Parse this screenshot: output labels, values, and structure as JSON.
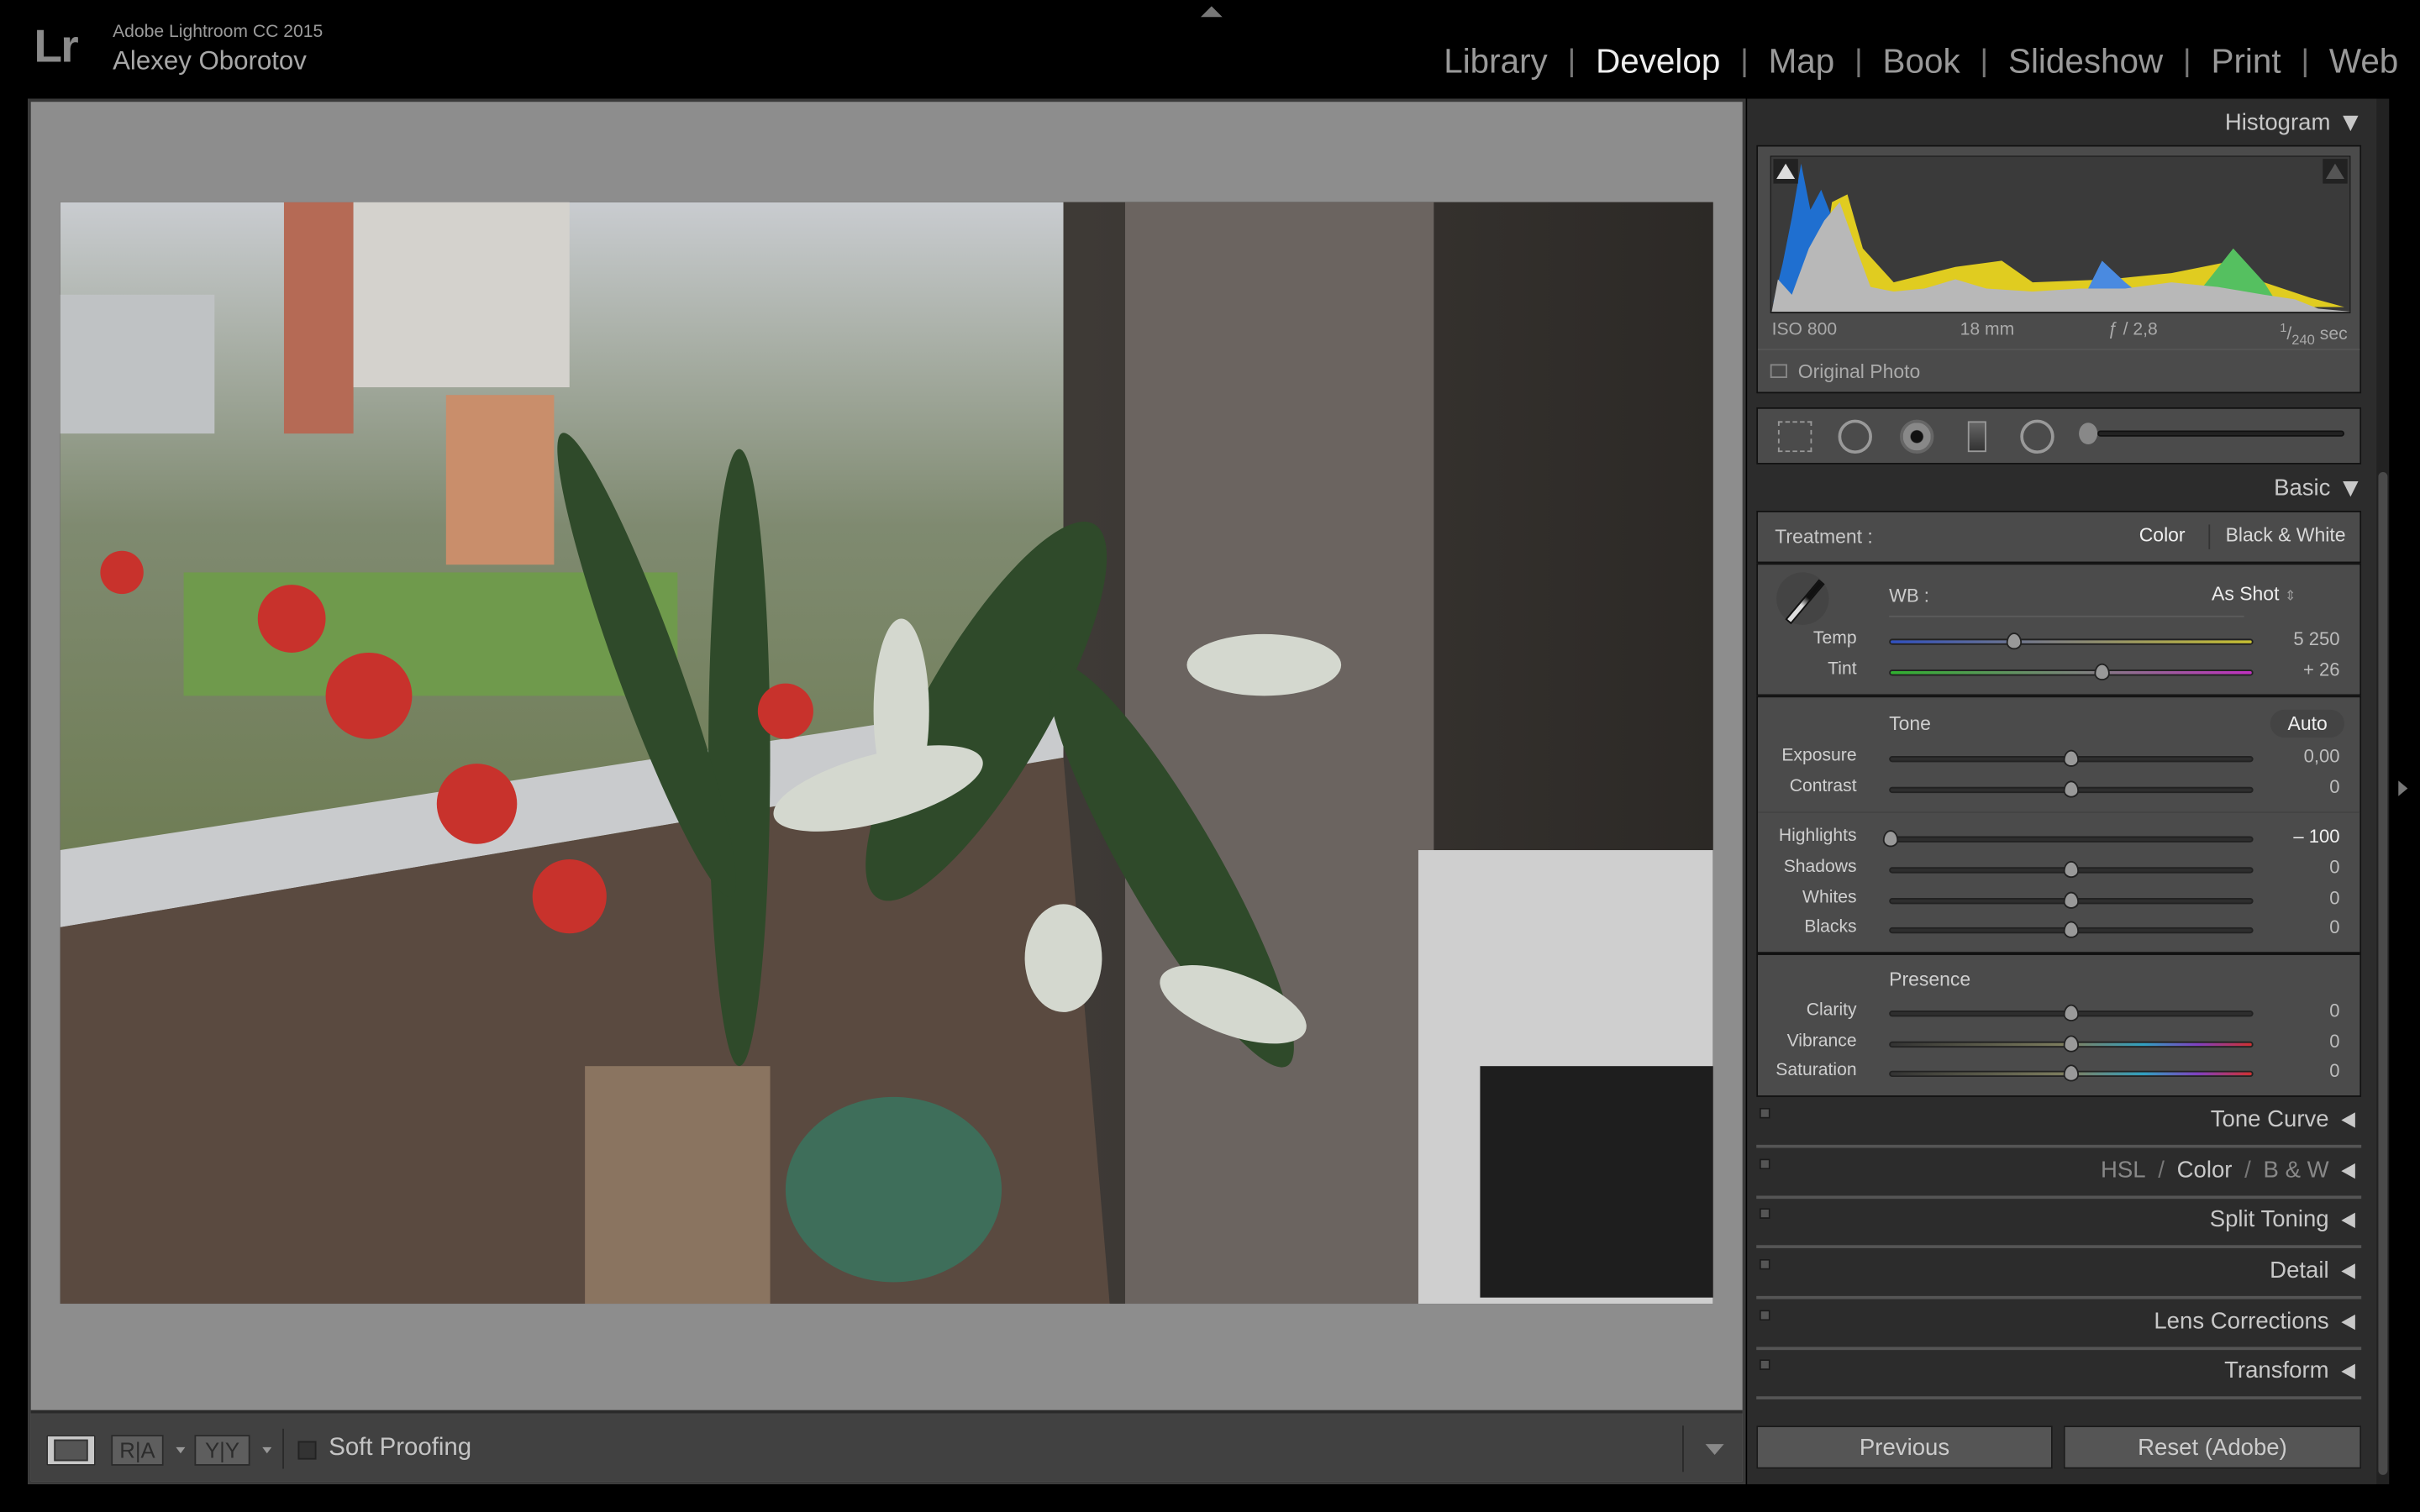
{
  "app": {
    "logo": "Lr",
    "title": "Adobe Lightroom CC 2015",
    "user": "Alexey Oborotov"
  },
  "modules": [
    {
      "label": "Library",
      "active": false
    },
    {
      "label": "Develop",
      "active": true
    },
    {
      "label": "Map",
      "active": false
    },
    {
      "label": "Book",
      "active": false
    },
    {
      "label": "Slideshow",
      "active": false
    },
    {
      "label": "Print",
      "active": false
    },
    {
      "label": "Web",
      "active": false
    }
  ],
  "toolbar": {
    "soft_proofing": "Soft Proofing",
    "soft_proofing_checked": false,
    "before_after_left": "R|A",
    "before_after_right": "Y|Y"
  },
  "histogram": {
    "title": "Histogram",
    "iso": "ISO 800",
    "focal": "18 mm",
    "aperture": "ƒ / 2,8",
    "shutter_num": "1",
    "shutter_den": "240",
    "shutter_unit": "sec",
    "original_photo": "Original Photo"
  },
  "tools": [
    "crop-overlay-icon",
    "spot-removal-icon",
    "red-eye-icon",
    "graduated-filter-icon",
    "radial-filter-icon",
    "adjustment-brush-icon"
  ],
  "basic": {
    "title": "Basic",
    "treatment_label": "Treatment :",
    "treatment_color": "Color",
    "treatment_bw": "Black & White",
    "wb_label": "WB :",
    "wb_value": "As Shot",
    "temp": {
      "label": "Temp",
      "value": "5 250",
      "position": 0.34
    },
    "tint": {
      "label": "Tint",
      "value": "+ 26",
      "position": 0.587
    },
    "tone_label": "Tone",
    "auto_label": "Auto",
    "sliders": [
      {
        "label": "Exposure",
        "value": "0,00",
        "position": 0.5
      },
      {
        "label": "Contrast",
        "value": "0",
        "position": 0.5
      },
      {
        "label": "Highlights",
        "value": "– 100",
        "position": 0.0
      },
      {
        "label": "Shadows",
        "value": "0",
        "position": 0.5
      },
      {
        "label": "Whites",
        "value": "0",
        "position": 0.5
      },
      {
        "label": "Blacks",
        "value": "0",
        "position": 0.5
      }
    ],
    "presence_label": "Presence",
    "presence": [
      {
        "label": "Clarity",
        "value": "0",
        "position": 0.5
      },
      {
        "label": "Vibrance",
        "value": "0",
        "position": 0.5
      },
      {
        "label": "Saturation",
        "value": "0",
        "position": 0.5
      }
    ]
  },
  "panels": {
    "tone_curve": "Tone Curve",
    "hsl": "HSL",
    "color": "Color",
    "bw": "B & W",
    "split_toning": "Split Toning",
    "detail": "Detail",
    "lens": "Lens Corrections",
    "transform": "Transform"
  },
  "buttons": {
    "previous": "Previous",
    "reset": "Reset (Adobe)"
  }
}
